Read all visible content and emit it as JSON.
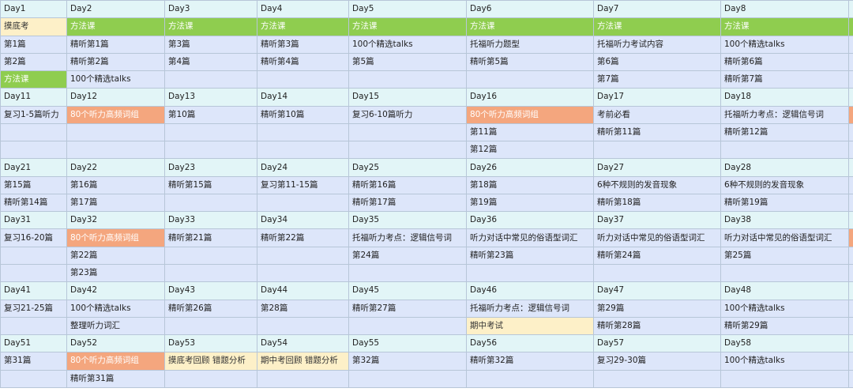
{
  "columns": [
    "c1",
    "c2",
    "c3",
    "c4",
    "c5",
    "c6",
    "c7",
    "c8",
    "c9"
  ],
  "rows": [
    {
      "type": "hdr",
      "cells": [
        {
          "t": "Day1"
        },
        {
          "t": "Day2"
        },
        {
          "t": "Day3"
        },
        {
          "t": "Day4"
        },
        {
          "t": "Day5"
        },
        {
          "t": "Day6"
        },
        {
          "t": "Day7"
        },
        {
          "t": "Day8"
        },
        {
          "t": ""
        }
      ]
    },
    {
      "type": "cont",
      "cells": [
        {
          "t": "摸底考",
          "c": "yellow"
        },
        {
          "t": "方法课",
          "c": "green"
        },
        {
          "t": "方法课",
          "c": "green"
        },
        {
          "t": "方法课",
          "c": "green"
        },
        {
          "t": "方法课",
          "c": "green"
        },
        {
          "t": "方法课",
          "c": "green"
        },
        {
          "t": "方法课",
          "c": "green"
        },
        {
          "t": "方法课",
          "c": "green"
        },
        {
          "t": "",
          "c": "green"
        }
      ]
    },
    {
      "type": "cont",
      "cells": [
        {
          "t": "第1篇"
        },
        {
          "t": "精听第1篇"
        },
        {
          "t": "第3篇"
        },
        {
          "t": "精听第3篇"
        },
        {
          "t": "100个精选talks"
        },
        {
          "t": "托福听力题型"
        },
        {
          "t": "托福听力考试内容"
        },
        {
          "t": "100个精选talks"
        },
        {
          "t": ""
        }
      ]
    },
    {
      "type": "cont",
      "cells": [
        {
          "t": "第2篇"
        },
        {
          "t": "精听第2篇"
        },
        {
          "t": "第4篇"
        },
        {
          "t": "精听第4篇"
        },
        {
          "t": "第5篇"
        },
        {
          "t": "精听第5篇"
        },
        {
          "t": "第6篇"
        },
        {
          "t": "精听第6篇"
        },
        {
          "t": ""
        }
      ]
    },
    {
      "type": "cont",
      "cells": [
        {
          "t": "方法课",
          "c": "green"
        },
        {
          "t": "100个精选talks"
        },
        {
          "t": ""
        },
        {
          "t": ""
        },
        {
          "t": ""
        },
        {
          "t": ""
        },
        {
          "t": "第7篇"
        },
        {
          "t": "精听第7篇"
        },
        {
          "t": ""
        }
      ]
    },
    {
      "type": "hdr",
      "cells": [
        {
          "t": "Day11"
        },
        {
          "t": "Day12"
        },
        {
          "t": "Day13"
        },
        {
          "t": "Day14"
        },
        {
          "t": "Day15"
        },
        {
          "t": "Day16"
        },
        {
          "t": "Day17"
        },
        {
          "t": "Day18"
        },
        {
          "t": ""
        }
      ]
    },
    {
      "type": "cont",
      "cells": [
        {
          "t": "复习1-5篇听力"
        },
        {
          "t": "80个听力高频词组",
          "c": "orange"
        },
        {
          "t": "第10篇"
        },
        {
          "t": "精听第10篇"
        },
        {
          "t": "复习6-10篇听力"
        },
        {
          "t": "80个听力高频词组",
          "c": "orange"
        },
        {
          "t": "考前必看"
        },
        {
          "t": "托福听力考点：逻辑信号词"
        },
        {
          "t": "",
          "c": "orange"
        }
      ]
    },
    {
      "type": "cont",
      "cells": [
        {
          "t": ""
        },
        {
          "t": ""
        },
        {
          "t": ""
        },
        {
          "t": ""
        },
        {
          "t": ""
        },
        {
          "t": "第11篇"
        },
        {
          "t": "精听第11篇"
        },
        {
          "t": "精听第12篇"
        },
        {
          "t": ""
        }
      ]
    },
    {
      "type": "cont",
      "cells": [
        {
          "t": ""
        },
        {
          "t": ""
        },
        {
          "t": ""
        },
        {
          "t": ""
        },
        {
          "t": ""
        },
        {
          "t": "第12篇"
        },
        {
          "t": ""
        },
        {
          "t": ""
        },
        {
          "t": ""
        }
      ]
    },
    {
      "type": "hdr",
      "cells": [
        {
          "t": "Day21"
        },
        {
          "t": "Day22"
        },
        {
          "t": "Day23"
        },
        {
          "t": "Day24"
        },
        {
          "t": "Day25"
        },
        {
          "t": "Day26"
        },
        {
          "t": "Day27"
        },
        {
          "t": "Day28"
        },
        {
          "t": ""
        }
      ]
    },
    {
      "type": "cont",
      "cells": [
        {
          "t": "第15篇"
        },
        {
          "t": "第16篇"
        },
        {
          "t": "精听第15篇"
        },
        {
          "t": "复习第11-15篇"
        },
        {
          "t": "精听第16篇"
        },
        {
          "t": "第18篇"
        },
        {
          "t": "6种不规则的发音现象"
        },
        {
          "t": "6种不规则的发音现象"
        },
        {
          "t": ""
        }
      ]
    },
    {
      "type": "cont",
      "cells": [
        {
          "t": "精听第14篇"
        },
        {
          "t": "第17篇"
        },
        {
          "t": ""
        },
        {
          "t": ""
        },
        {
          "t": "精听第17篇"
        },
        {
          "t": "第19篇"
        },
        {
          "t": "精听第18篇"
        },
        {
          "t": "精听第19篇"
        },
        {
          "t": ""
        }
      ]
    },
    {
      "type": "hdr",
      "cells": [
        {
          "t": "Day31"
        },
        {
          "t": "Day32"
        },
        {
          "t": "Day33"
        },
        {
          "t": "Day34"
        },
        {
          "t": "Day35"
        },
        {
          "t": "Day36"
        },
        {
          "t": "Day37"
        },
        {
          "t": "Day38"
        },
        {
          "t": ""
        }
      ]
    },
    {
      "type": "cont",
      "cells": [
        {
          "t": "复习16-20篇"
        },
        {
          "t": "80个听力高频词组",
          "c": "orange"
        },
        {
          "t": "精听第21篇"
        },
        {
          "t": "精听第22篇"
        },
        {
          "t": "托福听力考点：逻辑信号词"
        },
        {
          "t": "听力对话中常见的俗语型词汇"
        },
        {
          "t": "听力对话中常见的俗语型词汇"
        },
        {
          "t": "听力对话中常见的俗语型词汇"
        },
        {
          "t": "",
          "c": "orange"
        }
      ]
    },
    {
      "type": "cont",
      "cells": [
        {
          "t": ""
        },
        {
          "t": "第22篇"
        },
        {
          "t": ""
        },
        {
          "t": ""
        },
        {
          "t": "第24篇"
        },
        {
          "t": "精听第23篇"
        },
        {
          "t": "精听第24篇"
        },
        {
          "t": "第25篇"
        },
        {
          "t": ""
        }
      ]
    },
    {
      "type": "cont",
      "cells": [
        {
          "t": ""
        },
        {
          "t": "第23篇"
        },
        {
          "t": ""
        },
        {
          "t": ""
        },
        {
          "t": ""
        },
        {
          "t": ""
        },
        {
          "t": ""
        },
        {
          "t": ""
        },
        {
          "t": ""
        }
      ]
    },
    {
      "type": "hdr",
      "cells": [
        {
          "t": "Day41"
        },
        {
          "t": "Day42"
        },
        {
          "t": "Day43"
        },
        {
          "t": "Day44"
        },
        {
          "t": "Day45"
        },
        {
          "t": "Day46"
        },
        {
          "t": "Day47"
        },
        {
          "t": "Day48"
        },
        {
          "t": ""
        }
      ]
    },
    {
      "type": "cont",
      "cells": [
        {
          "t": "复习21-25篇"
        },
        {
          "t": "100个精选talks"
        },
        {
          "t": "精听第26篇"
        },
        {
          "t": "第28篇"
        },
        {
          "t": "精听第27篇"
        },
        {
          "t": "托福听力考点：逻辑信号词"
        },
        {
          "t": "第29篇"
        },
        {
          "t": "100个精选talks"
        },
        {
          "t": ""
        }
      ]
    },
    {
      "type": "cont",
      "cells": [
        {
          "t": ""
        },
        {
          "t": "整理听力词汇"
        },
        {
          "t": ""
        },
        {
          "t": ""
        },
        {
          "t": ""
        },
        {
          "t": "期中考试",
          "c": "yellow"
        },
        {
          "t": "精听第28篇"
        },
        {
          "t": "精听第29篇"
        },
        {
          "t": ""
        }
      ]
    },
    {
      "type": "hdr",
      "cells": [
        {
          "t": "Day51"
        },
        {
          "t": "Day52"
        },
        {
          "t": "Day53"
        },
        {
          "t": "Day54"
        },
        {
          "t": "Day55"
        },
        {
          "t": "Day56"
        },
        {
          "t": "Day57"
        },
        {
          "t": "Day58"
        },
        {
          "t": ""
        }
      ]
    },
    {
      "type": "cont",
      "cells": [
        {
          "t": "第31篇"
        },
        {
          "t": "80个听力高频词组",
          "c": "orange"
        },
        {
          "t": "摸底考回顾 错题分析",
          "c": "yellow"
        },
        {
          "t": "期中考回顾 错题分析",
          "c": "yellow"
        },
        {
          "t": "第32篇"
        },
        {
          "t": "精听第32篇"
        },
        {
          "t": "复习29-30篇"
        },
        {
          "t": "100个精选talks"
        },
        {
          "t": ""
        }
      ]
    },
    {
      "type": "cont",
      "cells": [
        {
          "t": ""
        },
        {
          "t": "精听第31篇"
        },
        {
          "t": ""
        },
        {
          "t": ""
        },
        {
          "t": ""
        },
        {
          "t": ""
        },
        {
          "t": ""
        },
        {
          "t": ""
        },
        {
          "t": ""
        }
      ]
    }
  ],
  "colors": {
    "header_bg": "#e2f5f7",
    "content_bg": "#dde6fa",
    "green": "#8fcd4f",
    "orange": "#f4a67e",
    "yellow": "#fdf0c8",
    "border": "#b7c6d8"
  }
}
